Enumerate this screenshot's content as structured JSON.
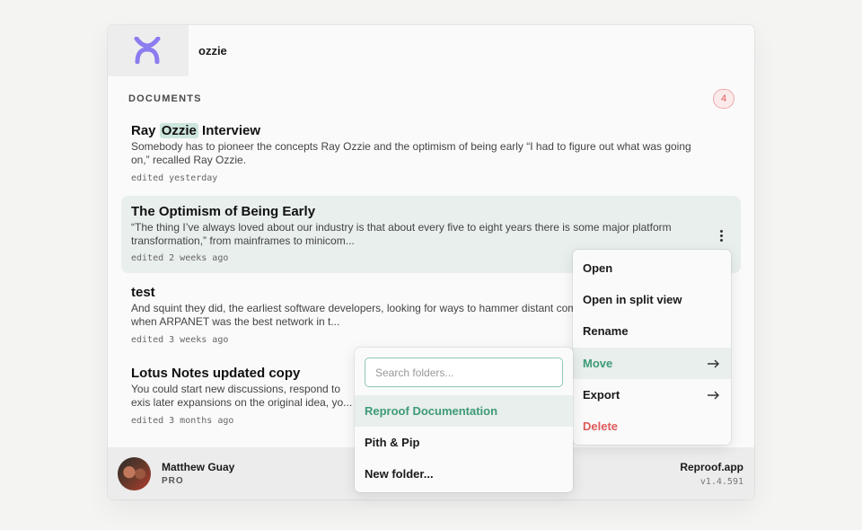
{
  "header": {
    "search_query": "ozzie",
    "logo_icon": "reproof-logo-icon",
    "brand_color": "#8b7cf0"
  },
  "documents": {
    "heading": "DOCUMENTS",
    "count": "4",
    "items": [
      {
        "title_before": "Ray ",
        "title_highlight": "Ozzie",
        "title_after": " Interview",
        "excerpt": "Somebody has to pioneer the concepts Ray Ozzie and the optimism of being early “I had to figure out what was going on,” recalled Ray Ozzie.",
        "meta": "edited yesterday"
      },
      {
        "title": "The Optimism of Being Early",
        "excerpt": "“The thing I’ve always loved about our industry is that about every five to eight years there is some major platform transformation,” from mainframes to minicom...",
        "meta": "edited 2 weeks ago",
        "selected": true
      },
      {
        "title": "test",
        "excerpt": "And squint they did, the earliest software developers, looking for ways to hammer distant compu when ARPANET was the best network in t...",
        "meta": "edited 3 weeks ago"
      },
      {
        "title": "Lotus Notes updated copy",
        "excerpt": "You could start new discussions, respond to exis later expansions on the original idea, yo...",
        "meta": "edited 3 months ago"
      }
    ]
  },
  "context_menu": {
    "items": [
      {
        "label": "Open"
      },
      {
        "label": "Open in split view"
      },
      {
        "label": "Rename"
      },
      {
        "label": "Move",
        "active": true,
        "icon": "arrow-right-icon"
      },
      {
        "label": "Export",
        "icon": "arrow-right-icon"
      },
      {
        "label": "Delete",
        "danger": true
      }
    ]
  },
  "move_submenu": {
    "search_placeholder": "Search folders...",
    "folders": [
      {
        "label": "Reproof Documentation",
        "active": true
      },
      {
        "label": "Pith & Pip"
      },
      {
        "label": "New folder..."
      }
    ]
  },
  "footer": {
    "user_name": "Matthew Guay",
    "user_plan": "PRO",
    "app_name": "Reproof.app",
    "version": "v1.4.591"
  },
  "colors": {
    "accent": "#3e9a78",
    "selected_bg": "#e8efec",
    "danger": "#e05a5a",
    "highlight": "#cde6dc"
  }
}
